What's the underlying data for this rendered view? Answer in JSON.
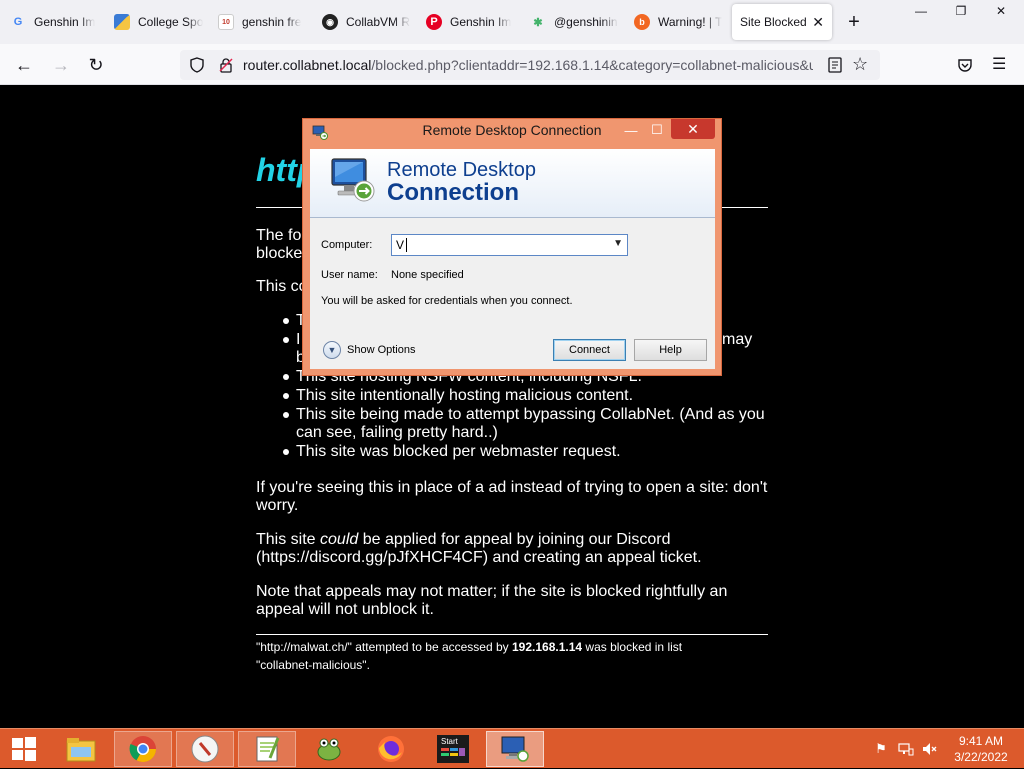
{
  "browser": {
    "tabs": [
      {
        "label": "Genshin Im",
        "icon": "google-icon"
      },
      {
        "label": "College Spo",
        "icon": "college-site-icon"
      },
      {
        "label": "genshin fre",
        "icon": "top10-site-icon"
      },
      {
        "label": "CollabVM R",
        "icon": "collabvm-icon"
      },
      {
        "label": "Genshin Im",
        "icon": "pinterest-icon"
      },
      {
        "label": "@genshinin",
        "icon": "linktree-icon"
      },
      {
        "label": "Warning! | T",
        "icon": "warning-site-icon"
      },
      {
        "label": "Site Blocked",
        "icon": "none",
        "active": true
      }
    ],
    "url": {
      "host": "router.collabnet.local",
      "rest": "/blocked.php?clientaddr=192.168.1.14&category=collabnet-malicious&u"
    }
  },
  "page": {
    "heading": "http",
    "para1": "The fo",
    "para1b": "blocke",
    "para2": "This co",
    "reasons": [
      "T",
      "I",
      "This site hosting NSFW content, including NSFL.",
      "This site intentionally hosting malicious content.",
      "This site being made to attempt bypassing CollabNet. (And as you can see, failing pretty hard..)",
      "This site was blocked per webmaster request."
    ],
    "reason2_tail": "may",
    "reason2_cont": "b",
    "ad_note": "If you're seeing this in place of a ad instead of trying to open a site: don't worry.",
    "appeal_pre": "This site ",
    "appeal_em": "could",
    "appeal_post": " be applied for appeal by joining our Discord (https://discord.gg/pJfXHCF4CF) and creating an appeal ticket.",
    "appeal_note": "Note that appeals may not matter; if the site is blocked rightfully an appeal will not unblock it.",
    "footer": {
      "pre": "\"http://malwat.ch/\" attempted to be accessed by ",
      "ip": "192.168.1.14",
      "mid": " was blocked in list",
      "list": "\"collabnet-malicious\"."
    }
  },
  "rdp_dialog": {
    "title": "Remote Desktop Connection",
    "brand_line1": "Remote Desktop",
    "brand_line2": "Connection",
    "computer_label": "Computer:",
    "computer_value": "V",
    "username_label": "User name:",
    "username_value": "None specified",
    "credentials_note": "You will be asked for credentials when you connect.",
    "show_options": "Show Options",
    "connect": "Connect",
    "help": "Help"
  },
  "taskbar": {
    "apps": [
      {
        "name": "file-explorer-icon",
        "state": "pinned"
      },
      {
        "name": "chrome-icon",
        "state": "running"
      },
      {
        "name": "compass-app-icon",
        "state": "running"
      },
      {
        "name": "notepad-plus-plus-icon",
        "state": "running"
      },
      {
        "name": "frog-app-icon",
        "state": "pinned"
      },
      {
        "name": "firefox-icon",
        "state": "pinned"
      },
      {
        "name": "start-app-icon",
        "state": "pinned",
        "label": "Start"
      },
      {
        "name": "remote-desktop-icon",
        "state": "active"
      }
    ],
    "clock_time": "9:41 AM",
    "clock_date": "3/22/2022"
  },
  "colors": {
    "heading_cyan": "#22d3e6",
    "taskbar_orange": "#dc5a2c",
    "dialog_frame": "#f0966f",
    "brand_blue": "#0e3f8f"
  }
}
